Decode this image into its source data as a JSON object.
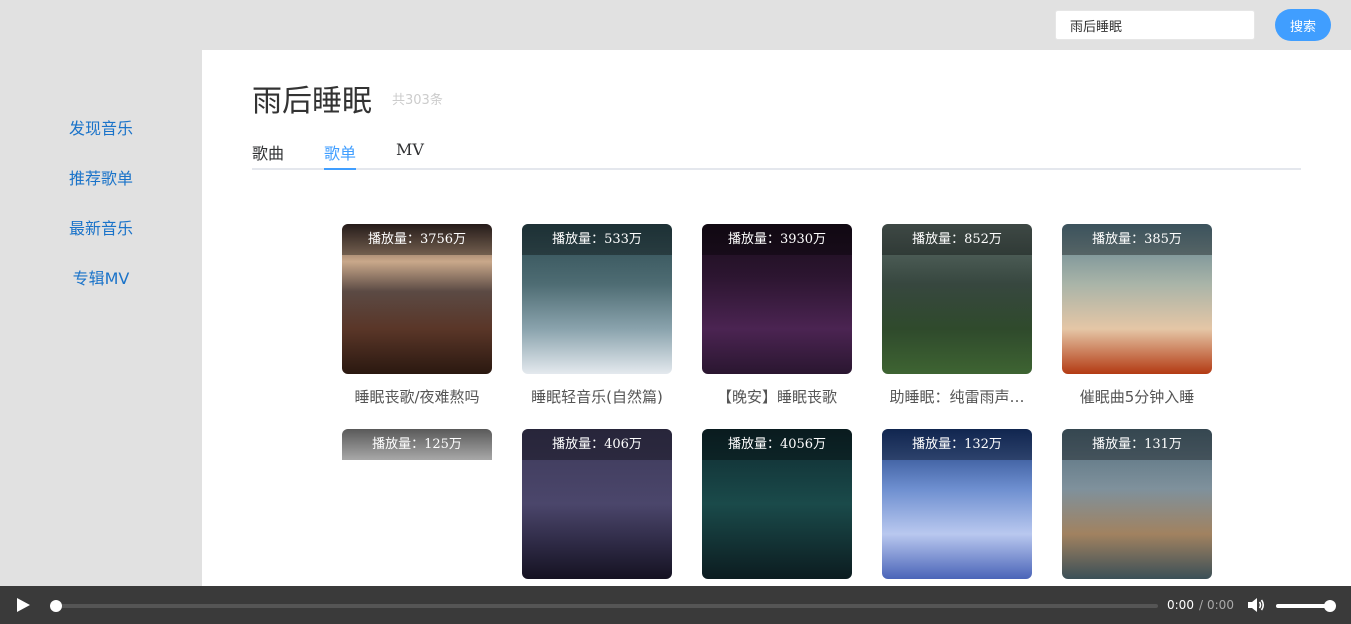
{
  "search": {
    "value": "雨后睡眠",
    "button_label": "搜索"
  },
  "sidebar": {
    "items": [
      {
        "label": "发现音乐"
      },
      {
        "label": "推荐歌单"
      },
      {
        "label": "最新音乐"
      },
      {
        "label": "专辑MV"
      }
    ]
  },
  "main": {
    "title": "雨后睡眠",
    "count": "共303条",
    "tabs": [
      {
        "label": "歌曲",
        "active": false
      },
      {
        "label": "歌单",
        "active": true
      },
      {
        "label": "MV",
        "active": false
      }
    ]
  },
  "playlists": [
    {
      "play_count": "播放量：3756万",
      "title": "睡眠丧歌/夜难熬吗"
    },
    {
      "play_count": "播放量：533万",
      "title": "睡眠轻音乐(自然篇)"
    },
    {
      "play_count": "播放量：3930万",
      "title": "【晚安】睡眠丧歌"
    },
    {
      "play_count": "播放量：852万",
      "title": "助睡眠：纯雷雨声…"
    },
    {
      "play_count": "播放量：385万",
      "title": "催眠曲5分钟入睡"
    },
    {
      "play_count": "播放量：125万",
      "title": ""
    },
    {
      "play_count": "播放量：406万",
      "title": ""
    },
    {
      "play_count": "播放量：4056万",
      "title": ""
    },
    {
      "play_count": "播放量：132万",
      "title": ""
    },
    {
      "play_count": "播放量：131万",
      "title": ""
    }
  ],
  "player": {
    "current_time": "0:00",
    "separator": "/",
    "total_time": "0:00",
    "progress": 0,
    "volume": 1.0
  },
  "colors": {
    "accent": "#409eff",
    "link": "#1a73c9",
    "player_bg": "#3a3a3a"
  }
}
